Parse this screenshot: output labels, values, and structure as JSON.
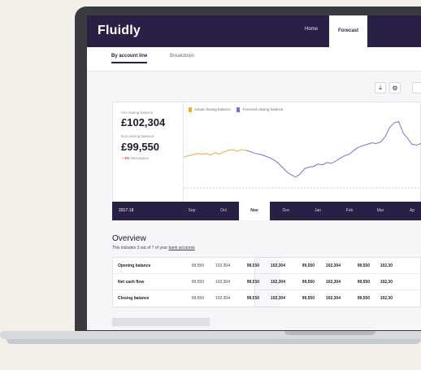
{
  "brand": {
    "logo": "Fluidly"
  },
  "nav": {
    "home": "Home",
    "forecast": "Forecast"
  },
  "tabs": {
    "by_account_line": "By account line",
    "breakdown": "Breakdown"
  },
  "toolbar": {
    "download_icon": "download-icon",
    "settings_icon": "gear-icon"
  },
  "stats": {
    "oct_label": "Oct closing balance",
    "oct_value": "£102,304",
    "nov_label": "Nov closing balance",
    "nov_value": "£99,550",
    "delta": "• 3%",
    "delta_desc": "Description"
  },
  "legend": {
    "actual": "Actual closing balance",
    "forecast": "Forecast closing balance",
    "actual_color": "#f2a93b",
    "forecast_color": "#7b6fd0"
  },
  "timeline": {
    "year": "2017-18",
    "months": [
      "Sep",
      "Oct",
      "Nov",
      "Dec",
      "Jan",
      "Feb",
      "Mar",
      "Ap"
    ],
    "active": "Nov"
  },
  "overview": {
    "title": "Overview",
    "sub_prefix": "This includes 3 out of 7 of your",
    "sub_link": "bank accounts"
  },
  "table": {
    "rows": [
      {
        "label": "Opening balance",
        "cells": [
          "99,550",
          "102,304",
          "99,550",
          "102,304",
          "99,550",
          "102,304",
          "99,550",
          "102,30"
        ]
      },
      {
        "label": "Net cash flow",
        "cells": [
          "99,550",
          "102,304",
          "99,550",
          "102,304",
          "99,550",
          "102,304",
          "99,550",
          "102,30"
        ]
      },
      {
        "label": "Closing balance",
        "cells": [
          "99,550",
          "102,304",
          "99,550",
          "102,304",
          "99,550",
          "102,304",
          "99,550",
          "102,30"
        ]
      }
    ]
  },
  "chart_data": {
    "type": "line",
    "series": [
      {
        "name": "Actual closing balance",
        "color": "#f2a93b",
        "points": [
          [
            0,
            53
          ],
          [
            1,
            55
          ],
          [
            2,
            56
          ],
          [
            3,
            58
          ],
          [
            4,
            57
          ],
          [
            5,
            58
          ],
          [
            6,
            56
          ],
          [
            7,
            59
          ],
          [
            8,
            57
          ],
          [
            9,
            60
          ],
          [
            10,
            62
          ],
          [
            11,
            63
          ],
          [
            12,
            61
          ],
          [
            13,
            63
          ],
          [
            14,
            62
          ]
        ]
      },
      {
        "name": "Forecast closing balance",
        "color": "#7b6fd0",
        "points": [
          [
            14,
            62
          ],
          [
            15,
            60
          ],
          [
            16,
            58
          ],
          [
            17,
            57
          ],
          [
            18,
            55
          ],
          [
            19,
            53
          ],
          [
            20,
            50
          ],
          [
            21,
            46
          ],
          [
            22,
            40
          ],
          [
            23,
            34
          ],
          [
            24,
            30
          ],
          [
            25,
            27
          ],
          [
            26,
            31
          ],
          [
            27,
            38
          ],
          [
            28,
            40
          ],
          [
            29,
            41
          ],
          [
            30,
            44
          ],
          [
            31,
            43
          ],
          [
            32,
            46
          ],
          [
            33,
            45
          ],
          [
            34,
            48
          ],
          [
            35,
            52
          ],
          [
            36,
            55
          ],
          [
            37,
            57
          ],
          [
            38,
            62
          ],
          [
            39,
            66
          ],
          [
            40,
            68
          ],
          [
            41,
            70
          ],
          [
            42,
            72
          ],
          [
            43,
            71
          ],
          [
            44,
            73
          ],
          [
            45,
            80
          ],
          [
            46,
            92
          ],
          [
            47,
            98
          ],
          [
            48,
            100
          ],
          [
            49,
            85
          ],
          [
            50,
            78
          ],
          [
            51,
            70
          ],
          [
            52,
            69
          ],
          [
            53,
            71
          ]
        ]
      }
    ]
  }
}
